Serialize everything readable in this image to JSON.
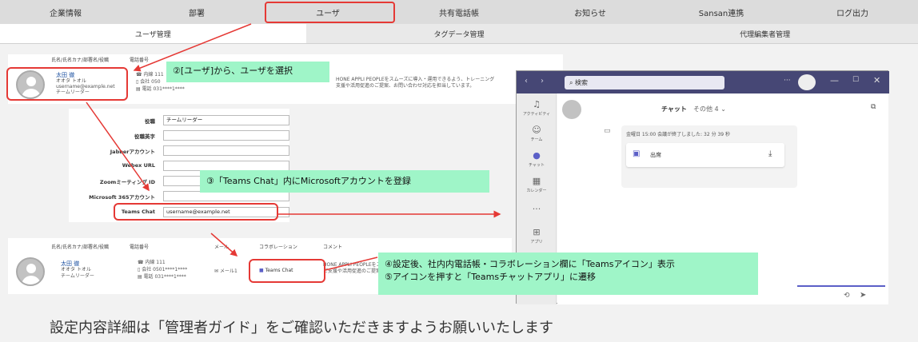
{
  "top_tabs": [
    "企業情報",
    "部署",
    "ユーザ",
    "共有電話帳",
    "お知らせ",
    "Sansan連携",
    "ログ出力"
  ],
  "sub_tabs": [
    "ユーザ管理",
    "タグデータ管理",
    "代理編集者管理"
  ],
  "headers": {
    "name_col": "氏名/氏名カナ/部署名/役職",
    "phone_col": "電話番号",
    "mail_col": "メール",
    "collab_col": "コラボレーション",
    "comment_col": "コメント"
  },
  "user_top": {
    "name": "太田 徹",
    "kana": "オオタ トオル",
    "email": "username@example.net",
    "role": "チームリーダー",
    "phone_ext": "内線 111",
    "phone_company": "会社 050",
    "phone_fax": "電話 031****1****",
    "comment": "HONE APPLI PEOPLEをスムーズに導入・運用できるよう、トレーニング",
    "comment2": "支援や活用促進のご提案、お問い合わせ対応を担当しています。"
  },
  "form": {
    "rows": [
      {
        "label": "役職",
        "value": "チームリーダー"
      },
      {
        "label": "役職英字",
        "value": ""
      },
      {
        "label": "Jabberアカウント",
        "value": ""
      },
      {
        "label": "Webex URL",
        "value": ""
      },
      {
        "label": "Zoomミーティング ID",
        "value": ""
      },
      {
        "label": "Microsoft 365アカウント",
        "value": ""
      },
      {
        "label": "Teams Chat",
        "value": "username@example.net"
      }
    ]
  },
  "user_bottom": {
    "name": "太田 徹",
    "kana": "オオタ トオル",
    "role": "チームリーダー",
    "phone_ext": "内線 111",
    "phone_company": "会社 0501****1****",
    "phone_fax": "電話 031****1****",
    "mail": "メール1",
    "teams_chat": "Teams Chat",
    "comment": "HONE APPLI PEOPLEをスムーズに導入・運用できるよう、トレーニング",
    "comment2": "ご支援や活用促進のご提案、お問い合わせ対応を担当しています。"
  },
  "callouts": {
    "step2": "②[ユーザ]から、ユーザを選択",
    "step3": "③「Teams Chat」内にMicrosoftアカウントを登録",
    "step4": "④設定後、社内内電話帳・コラボレーション欄に「Teamsアイコン」表示",
    "step5": "⑤アイコンを押すと「Teamsチャットアプリ」に遷移"
  },
  "teams": {
    "search": "検索",
    "header_chat": "チャット",
    "header_more": "その他 4",
    "meeting_line": "金曜日 15:00  会議が終了しました: 32 分 39 秒",
    "file_label": "出席",
    "rail": [
      "アクティビティ",
      "チーム",
      "チャット",
      "カレンダー",
      "...",
      "アプリ"
    ]
  },
  "bottom_note": "設定内容詳細は「管理者ガイド」をご確認いただきますようお願いいたします"
}
